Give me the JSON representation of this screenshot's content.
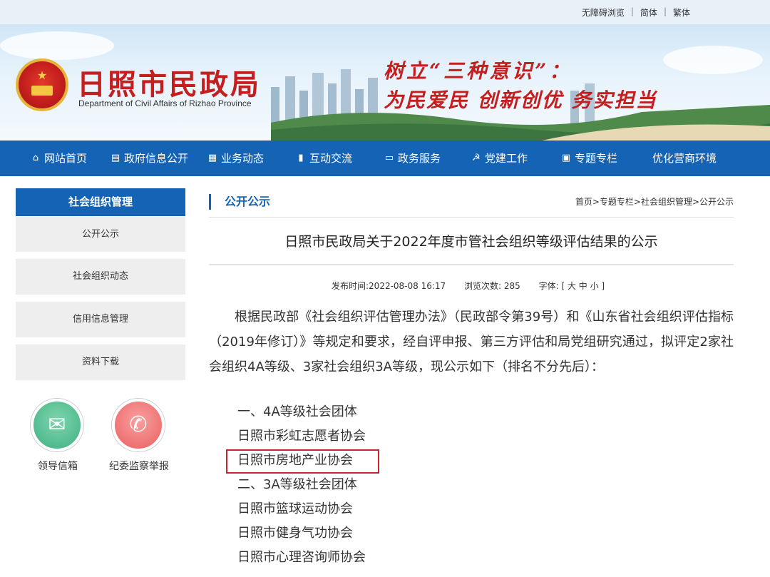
{
  "topbar": {
    "accessibility": "无障碍浏览",
    "simplified": "简体",
    "traditional": "繁体",
    "separator": "|"
  },
  "banner": {
    "site_title": "日照市民政局",
    "site_subtitle": "Department of Civil Affairs of Rizhao Province",
    "slogan_line1": "树立“三种意识”：",
    "slogan_line2": "为民爱民 创新创优 务实担当"
  },
  "nav": {
    "items": [
      {
        "label": "网站首页",
        "icon": "home-icon"
      },
      {
        "label": "政府信息公开",
        "icon": "document-icon"
      },
      {
        "label": "业务动态",
        "icon": "news-icon"
      },
      {
        "label": "互动交流",
        "icon": "chat-icon"
      },
      {
        "label": "政务服务",
        "icon": "service-icon"
      },
      {
        "label": "党建工作",
        "icon": "party-icon"
      },
      {
        "label": "专题专栏",
        "icon": "topic-icon"
      },
      {
        "label": "优化营商环境",
        "icon": ""
      }
    ]
  },
  "sidebar": {
    "heading": "社会组织管理",
    "items": [
      {
        "label": "公开公示"
      },
      {
        "label": "社会组织动态"
      },
      {
        "label": "信用信息管理"
      },
      {
        "label": "资料下载"
      }
    ],
    "quick_links": [
      {
        "label": "领导信箱",
        "icon": "mail-icon",
        "color": "#3fb182"
      },
      {
        "label": "纪委监察举报",
        "icon": "phone-icon",
        "color": "#ea5f5f"
      }
    ]
  },
  "main": {
    "section_title": "公开公示",
    "breadcrumb": "首页>专题专栏>社会组织管理>公开公示",
    "article_title": "日照市民政局关于2022年度市管社会组织等级评估结果的公示",
    "meta": {
      "publish_time": "发布时间:2022-08-08 16:17",
      "views": "浏览次数: 285",
      "font_size_label": "字体:",
      "font_size_options": "[ 大 中 小 ]"
    },
    "body_paragraph": "根据民政部《社会组织评估管理办法》（民政部令第39号）和《山东省社会组织评估指标（2019年修订）》等规定和要求，经自评申报、第三方评估和局党组研究通过，拟评定2家社会组织4A等级、3家社会组织3A等级，现公示如下（排名不分先后）：",
    "list_items": [
      "一、4A等级社会团体",
      "日照市彩虹志愿者协会",
      "日照市房地产业协会",
      "二、3A等级社会团体",
      "日照市篮球运动协会",
      "日照市健身气功协会",
      "日照市心理咨询师协会"
    ],
    "highlighted_item_index": 2,
    "accent_color": "#1463b5",
    "highlight_color": "#c8262c"
  }
}
